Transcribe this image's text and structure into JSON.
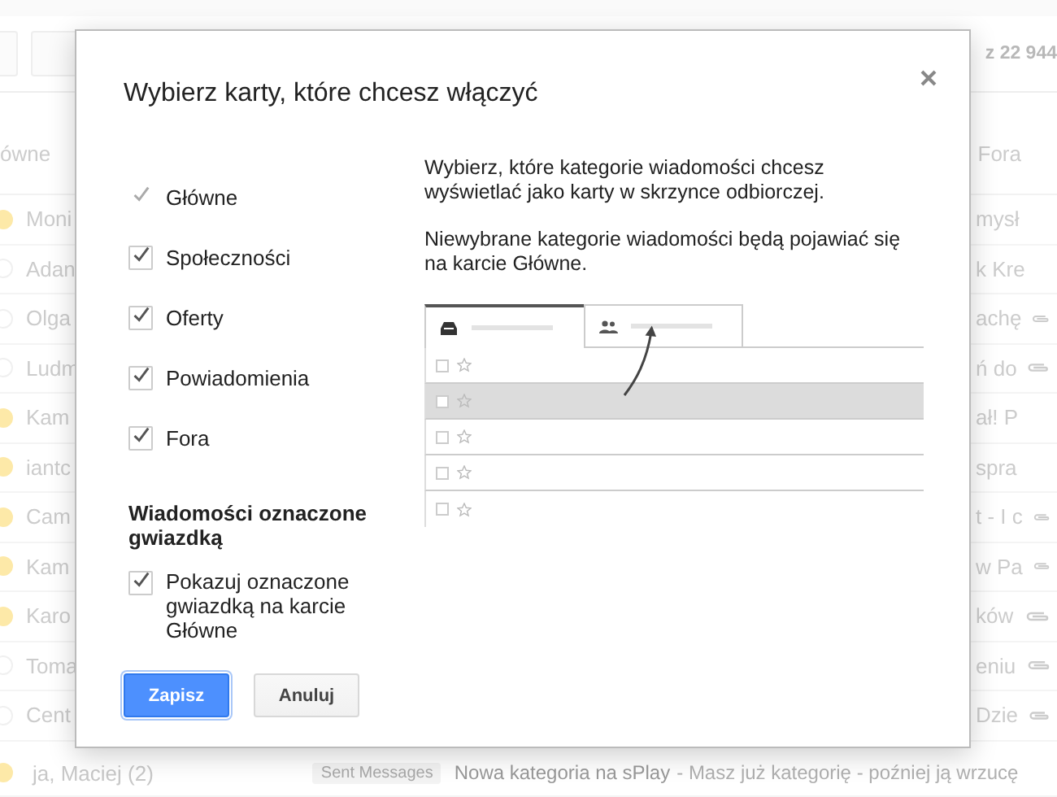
{
  "background": {
    "count": "z 22 944",
    "tab_left": "ówne",
    "tab_right": "Fora",
    "rows": [
      {
        "sender": "Moni",
        "marked": true,
        "fragment": "mysł",
        "attachment": false
      },
      {
        "sender": "Adan",
        "marked": false,
        "fragment": "k Kre",
        "attachment": false
      },
      {
        "sender": "Olga",
        "marked": false,
        "fragment": "achę",
        "attachment": true
      },
      {
        "sender": "Ludm",
        "marked": false,
        "fragment": "ń do",
        "attachment": true
      },
      {
        "sender": "Kam",
        "marked": true,
        "fragment": "ał! P",
        "attachment": false
      },
      {
        "sender": "iantc",
        "marked": true,
        "fragment": "spra",
        "attachment": false
      },
      {
        "sender": "Cam",
        "marked": true,
        "fragment": "t - I c",
        "attachment": true
      },
      {
        "sender": "Kam",
        "marked": true,
        "fragment": "w Pa",
        "attachment": true
      },
      {
        "sender": "Karo",
        "marked": true,
        "fragment": "ków",
        "attachment": true
      },
      {
        "sender": "Toma",
        "marked": false,
        "fragment": "eniu",
        "attachment": true
      },
      {
        "sender": "Cent",
        "marked": false,
        "fragment": "Dzie",
        "attachment": true
      }
    ],
    "last_row": {
      "sender": "ja, Maciej (2)",
      "marked": true,
      "label": "Sent Messages",
      "subject": "Nowa kategoria na sPlay",
      "snippet": "- Masz już kategorię - poźniej ją wrzucę"
    }
  },
  "dialog": {
    "title": "Wybierz karty, które chcesz włączyć",
    "categories": [
      {
        "label": "Główne",
        "checked": true,
        "disabled": true
      },
      {
        "label": "Społeczności",
        "checked": true,
        "disabled": false
      },
      {
        "label": "Oferty",
        "checked": true,
        "disabled": false
      },
      {
        "label": "Powiadomienia",
        "checked": true,
        "disabled": false
      },
      {
        "label": "Fora",
        "checked": true,
        "disabled": false
      }
    ],
    "starred_heading": "Wiadomości oznaczone gwiazdką",
    "starred_option": {
      "label": "Pokazuj oznaczone gwiazdką na karcie Główne",
      "checked": true
    },
    "description": [
      "Wybierz, które kategorie wiadomości chcesz wyświetlać jako karty w skrzynce odbiorczej.",
      "Niewybrane kategorie wiadomości będą pojawiać się na karcie Główne."
    ],
    "preview_tabs": [
      {
        "kind": "inbox",
        "selected": true
      },
      {
        "kind": "people",
        "selected": false
      }
    ],
    "preview_rows": [
      {
        "selected": false
      },
      {
        "selected": true
      },
      {
        "selected": false
      },
      {
        "selected": false
      },
      {
        "selected": false
      }
    ],
    "buttons": [
      {
        "label": "Zapisz",
        "kind": "primary"
      },
      {
        "label": "Anuluj",
        "kind": "secondary"
      }
    ]
  }
}
